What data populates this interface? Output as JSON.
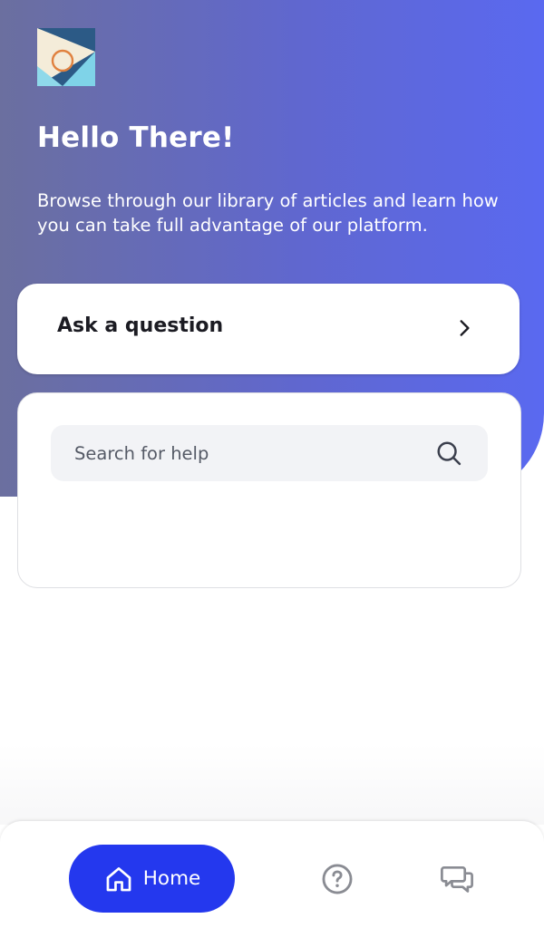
{
  "header": {
    "logo_icon": "brand-logo-icon",
    "greeting": "Hello There!",
    "subtitle": "Browse through our library of articles and learn how you can take full advantage of our platform."
  },
  "ask_card": {
    "label": "Ask a question",
    "icon": "chevron-right-icon"
  },
  "search": {
    "placeholder": "Search for help",
    "value": "",
    "icon": "search-icon"
  },
  "bottom_nav": {
    "items": [
      {
        "label": "Home",
        "icon": "home-icon",
        "active": true
      },
      {
        "label": "",
        "icon": "help-circle-icon",
        "active": false
      },
      {
        "label": "",
        "icon": "chat-bubbles-icon",
        "active": false
      }
    ]
  },
  "colors": {
    "hero_gradient_start": "#6b6f9f",
    "hero_gradient_end": "#5a69f0",
    "accent": "#2438ee",
    "text_dark": "#1b1b22",
    "search_bg": "#f2f3f6"
  }
}
